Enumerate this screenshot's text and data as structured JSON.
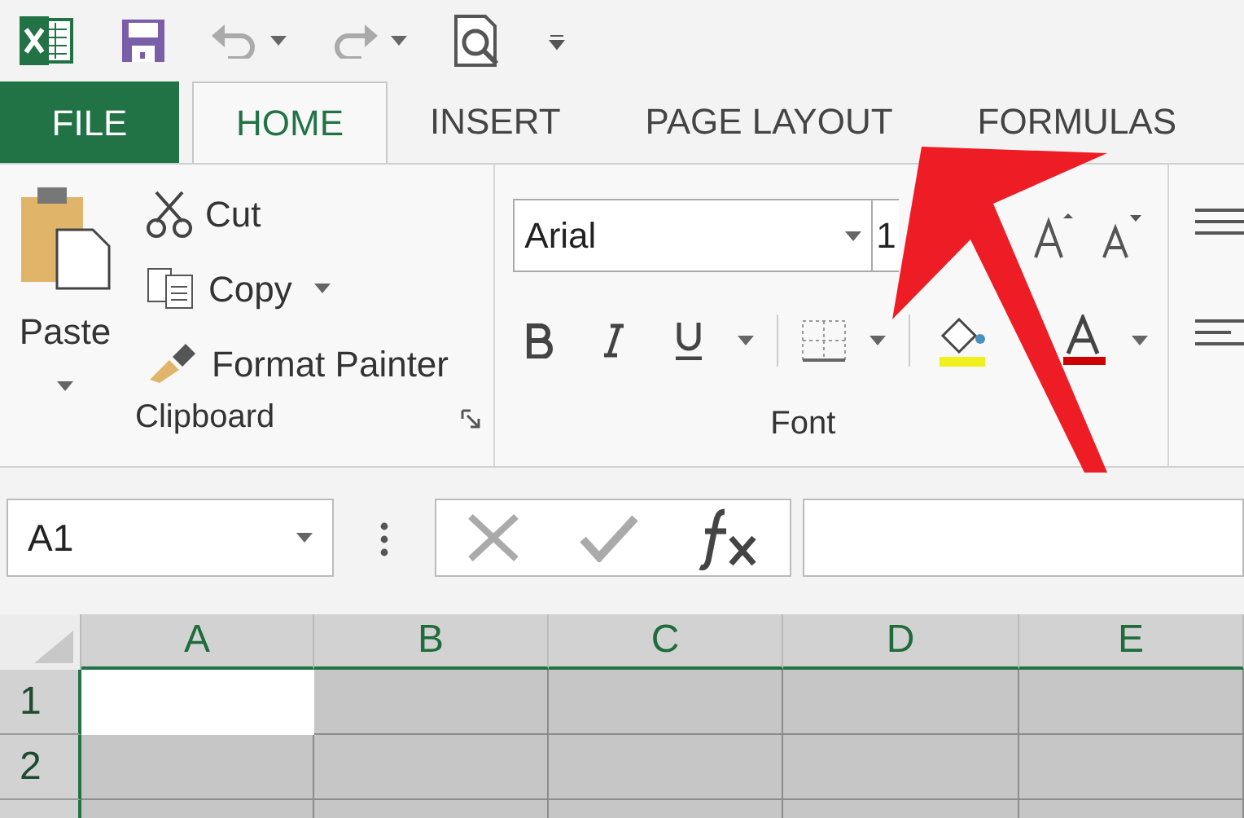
{
  "tabs": [
    {
      "label": "FILE",
      "kind": "file",
      "selected": false
    },
    {
      "label": "HOME",
      "kind": "tab",
      "selected": true
    },
    {
      "label": "INSERT",
      "kind": "tab",
      "selected": false
    },
    {
      "label": "PAGE LAYOUT",
      "kind": "tab",
      "selected": false
    },
    {
      "label": "FORMULAS",
      "kind": "tab",
      "selected": false
    }
  ],
  "clipboard": {
    "paste": "Paste",
    "cut": "Cut",
    "copy": "Copy",
    "format_painter": "Format Painter",
    "label": "Clipboard"
  },
  "font": {
    "name": "Arial",
    "size": "1",
    "label": "Font"
  },
  "name_box": "A1",
  "grid": {
    "columns": [
      {
        "label": "A",
        "selected": true
      },
      {
        "label": "B",
        "selected": true
      },
      {
        "label": "C",
        "selected": true
      },
      {
        "label": "D",
        "selected": true
      },
      {
        "label": "E",
        "selected": true
      }
    ],
    "rows": [
      {
        "label": "1",
        "selected": true,
        "cells": [
          {
            "current": true
          },
          {
            "current": false
          },
          {
            "current": false
          },
          {
            "current": false
          },
          {
            "current": false
          }
        ]
      },
      {
        "label": "2",
        "selected": true,
        "cells": [
          {
            "current": false
          },
          {
            "current": false
          },
          {
            "current": false
          },
          {
            "current": false
          },
          {
            "current": false
          }
        ]
      }
    ]
  }
}
